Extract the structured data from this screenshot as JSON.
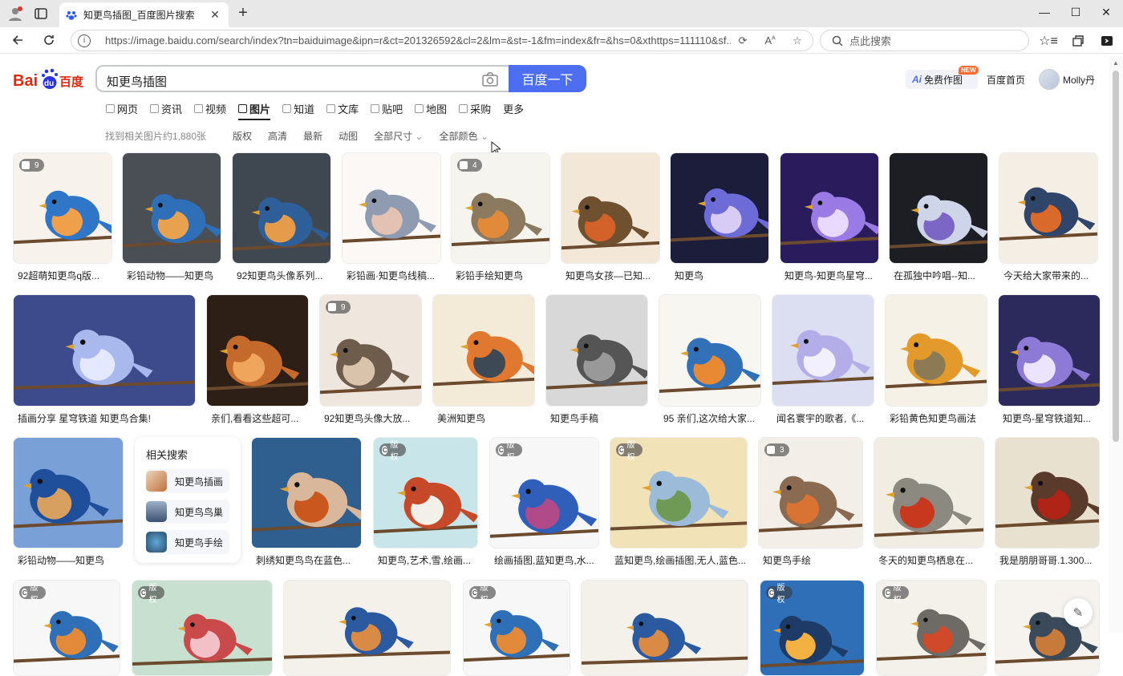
{
  "browser": {
    "tab_title": "知更鸟插图_百度图片搜索",
    "url": "https://image.baidu.com/search/index?tn=baiduimage&ipn=r&ct=201326592&cl=2&lm=&st=-1&fm=index&fr=&hs=0&xthttps=111110&sf...",
    "side_search_placeholder": "点此搜索"
  },
  "header": {
    "logo_text": "Bai百度",
    "query": "知更鸟插图",
    "search_button": "百度一下",
    "ai_button": "免费作图",
    "ai_prefix": "Ai",
    "new_badge": "NEW",
    "home_link": "百度首页",
    "username": "Molly丹"
  },
  "nav_tabs": [
    {
      "label": "网页",
      "active": false
    },
    {
      "label": "资讯",
      "active": false
    },
    {
      "label": "视频",
      "active": false
    },
    {
      "label": "图片",
      "active": true
    },
    {
      "label": "知道",
      "active": false
    },
    {
      "label": "文库",
      "active": false
    },
    {
      "label": "贴吧",
      "active": false
    },
    {
      "label": "地图",
      "active": false
    },
    {
      "label": "采购",
      "active": false
    },
    {
      "label": "更多",
      "active": false
    }
  ],
  "filters": {
    "result_count": "找到相关图片约1,880张",
    "items": [
      "版权",
      "高清",
      "最新",
      "动图",
      "全部尺寸",
      "全部颜色"
    ]
  },
  "related": {
    "title": "相关搜索",
    "items": [
      "知更鸟插画",
      "知更鸟鸟巢",
      "知更鸟手绘"
    ]
  },
  "colors": {
    "accent": "#4e6ef2",
    "badge_new": "#ff6a2f"
  },
  "results": {
    "row1": [
      {
        "caption": "92超萌知更鸟q版...",
        "badge": "9"
      },
      {
        "caption": "彩铅动物——知更鸟",
        "badge": ""
      },
      {
        "caption": "92知更鸟头像系列...",
        "badge": ""
      },
      {
        "caption": "彩铅画·知更鸟线稿...",
        "badge": ""
      },
      {
        "caption": "彩铅手绘知更鸟",
        "badge": "4"
      },
      {
        "caption": "知更鸟女孩—已知...",
        "badge": ""
      },
      {
        "caption": "知更鸟",
        "badge": ""
      },
      {
        "caption": "知更鸟-知更鸟星穹...",
        "badge": ""
      },
      {
        "caption": "在孤独中吟唱--知...",
        "badge": ""
      },
      {
        "caption": "今天给大家带来的...",
        "badge": ""
      }
    ],
    "row2": [
      {
        "caption": "插画分享 星穹铁道 知更鸟合集!",
        "badge": ""
      },
      {
        "caption": "亲们,看看这些超可...",
        "badge": ""
      },
      {
        "caption": "92知更鸟头像大放...",
        "badge": "9"
      },
      {
        "caption": "美洲知更鸟",
        "badge": ""
      },
      {
        "caption": "知更鸟手稿",
        "badge": ""
      },
      {
        "caption": "95 亲们,这次给大家...",
        "badge": ""
      },
      {
        "caption": "闻名寰宇的歌者,《...",
        "badge": ""
      },
      {
        "caption": "彩铅黄色知更鸟画法",
        "badge": ""
      },
      {
        "caption": "知更鸟-星穹铁道知...",
        "badge": ""
      }
    ],
    "row3": [
      {
        "caption": "彩铅动物——知更鸟",
        "badge": ""
      },
      {
        "caption": "刺绣知更鸟鸟在蓝色...",
        "badge": ""
      },
      {
        "caption": "知更鸟,艺术,雪,绘画...",
        "badge": "版权"
      },
      {
        "caption": "绘画插图,蓝知更鸟,水...",
        "badge": "版权"
      },
      {
        "caption": "蓝知更鸟,绘画插图,无人,蓝色...",
        "badge": "版权"
      },
      {
        "caption": "知更鸟手绘",
        "badge": "3"
      },
      {
        "caption": "冬天的知更鸟栖息在...",
        "badge": ""
      },
      {
        "caption": "我是朋朋哥哥.1.300...",
        "badge": ""
      }
    ],
    "row4_badges": [
      "版权",
      "版权",
      "",
      "版权",
      "",
      "版权",
      "版权",
      ""
    ]
  }
}
